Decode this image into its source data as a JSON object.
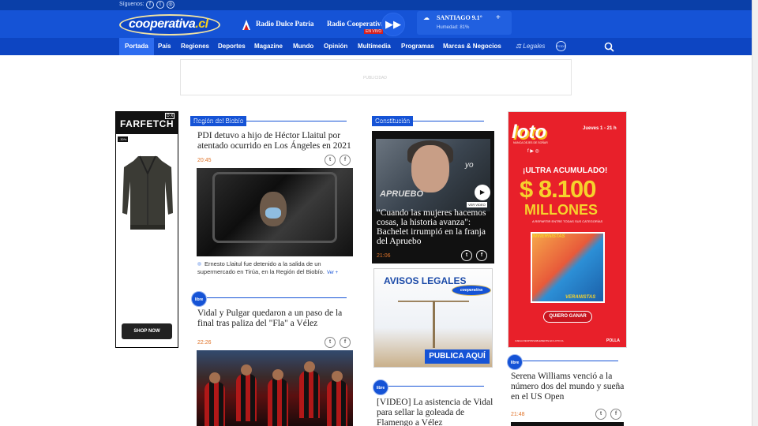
{
  "topbar": {
    "follow_label": "Síguenos:"
  },
  "header": {
    "logo_text": "cooperativa",
    "logo_dot": ".cl",
    "radio1": "Radio Dulce Patria",
    "radio2": "Radio Cooperativa",
    "live_badge": "EN VIVO",
    "weather": {
      "city": "SANTIAGO 9.1°",
      "humidity": "Humedad: 81%",
      "plus": "+"
    }
  },
  "nav": {
    "items": [
      "Portada",
      "País",
      "Regiones",
      "Deportes",
      "Magazine",
      "Mundo",
      "Opinión",
      "Multimedia",
      "Programas",
      "Marcas & Negocios"
    ],
    "legales": "Legales",
    "podcast": "PODC"
  },
  "ad_top": {
    "label": "PUBLICIDAD"
  },
  "ad_left": {
    "brand": "FARFETCH",
    "discount": "-30%",
    "cta": "SHOP NOW",
    "adchoice": "D X"
  },
  "col1": {
    "section": "Región del Biobío",
    "story1": {
      "headline": "PDI detuvo a hijo de Héctor Llaitul por atentado ocurrido en Los Ángeles en 2021",
      "time": "20:45",
      "caption": "Ernesto Llaitul fue detenido a la salida de un supermercado en Tirúa, en la Región del Biobío.",
      "more": "Ver +"
    },
    "libre_badge": "libre",
    "story2": {
      "headline": "Vidal y Pulgar quedaron a un paso de la final tras paliza del \"Fla\" a Vélez",
      "time": "22:26"
    }
  },
  "col2": {
    "section": "Constitución",
    "video": {
      "overlay_yo": "yo",
      "overlay_apruebo": "APRUEBO",
      "ver_video": "VER VIDEO",
      "headline": "\"Cuando las mujeres hacemos cosas, la historia avanza\": Bachelet irrumpió en la franja del Apruebo",
      "time": "21:06"
    },
    "avisos": {
      "title": "AVISOS LEGALES",
      "brand": "cooperativa",
      "cta": "PUBLICA AQUÍ"
    },
    "libre_badge": "libre",
    "story3": {
      "headline": "[VIDEO] La asistencia de Vidal para sellar la goleada de Flamengo a Vélez"
    }
  },
  "col3": {
    "loto": {
      "logo": "loto",
      "tagline": "NUNCA DEJES DE SOÑAR",
      "date": "Jueves 1 - 21 h",
      "ultra": "¡ULTRA ACUMULADO!",
      "amount": "$ 8.100",
      "millones": "MILLONES",
      "reparte": "A REPARTIR ENTRE TODAS SUS CATEGORÍAS",
      "invierno": "INVIERNISTAS",
      "verano": "VERANISTAS",
      "cta": "QUIERO GANAR",
      "foot": "JUEGA RESPONSABLEMENTE EN LOTO.CL",
      "polla": "POLLA"
    },
    "libre_badge": "libre",
    "story4": {
      "headline": "Serena Williams venció a la número dos del mundo y sueña en el US Open",
      "time": "21:48"
    }
  },
  "share_icons": {
    "twitter": "t",
    "facebook": "f"
  },
  "colors": {
    "brand_blue": "#1553d6",
    "nav_blue": "#0d45c2",
    "time_orange": "#e0742a",
    "loto_red": "#e8202a"
  }
}
